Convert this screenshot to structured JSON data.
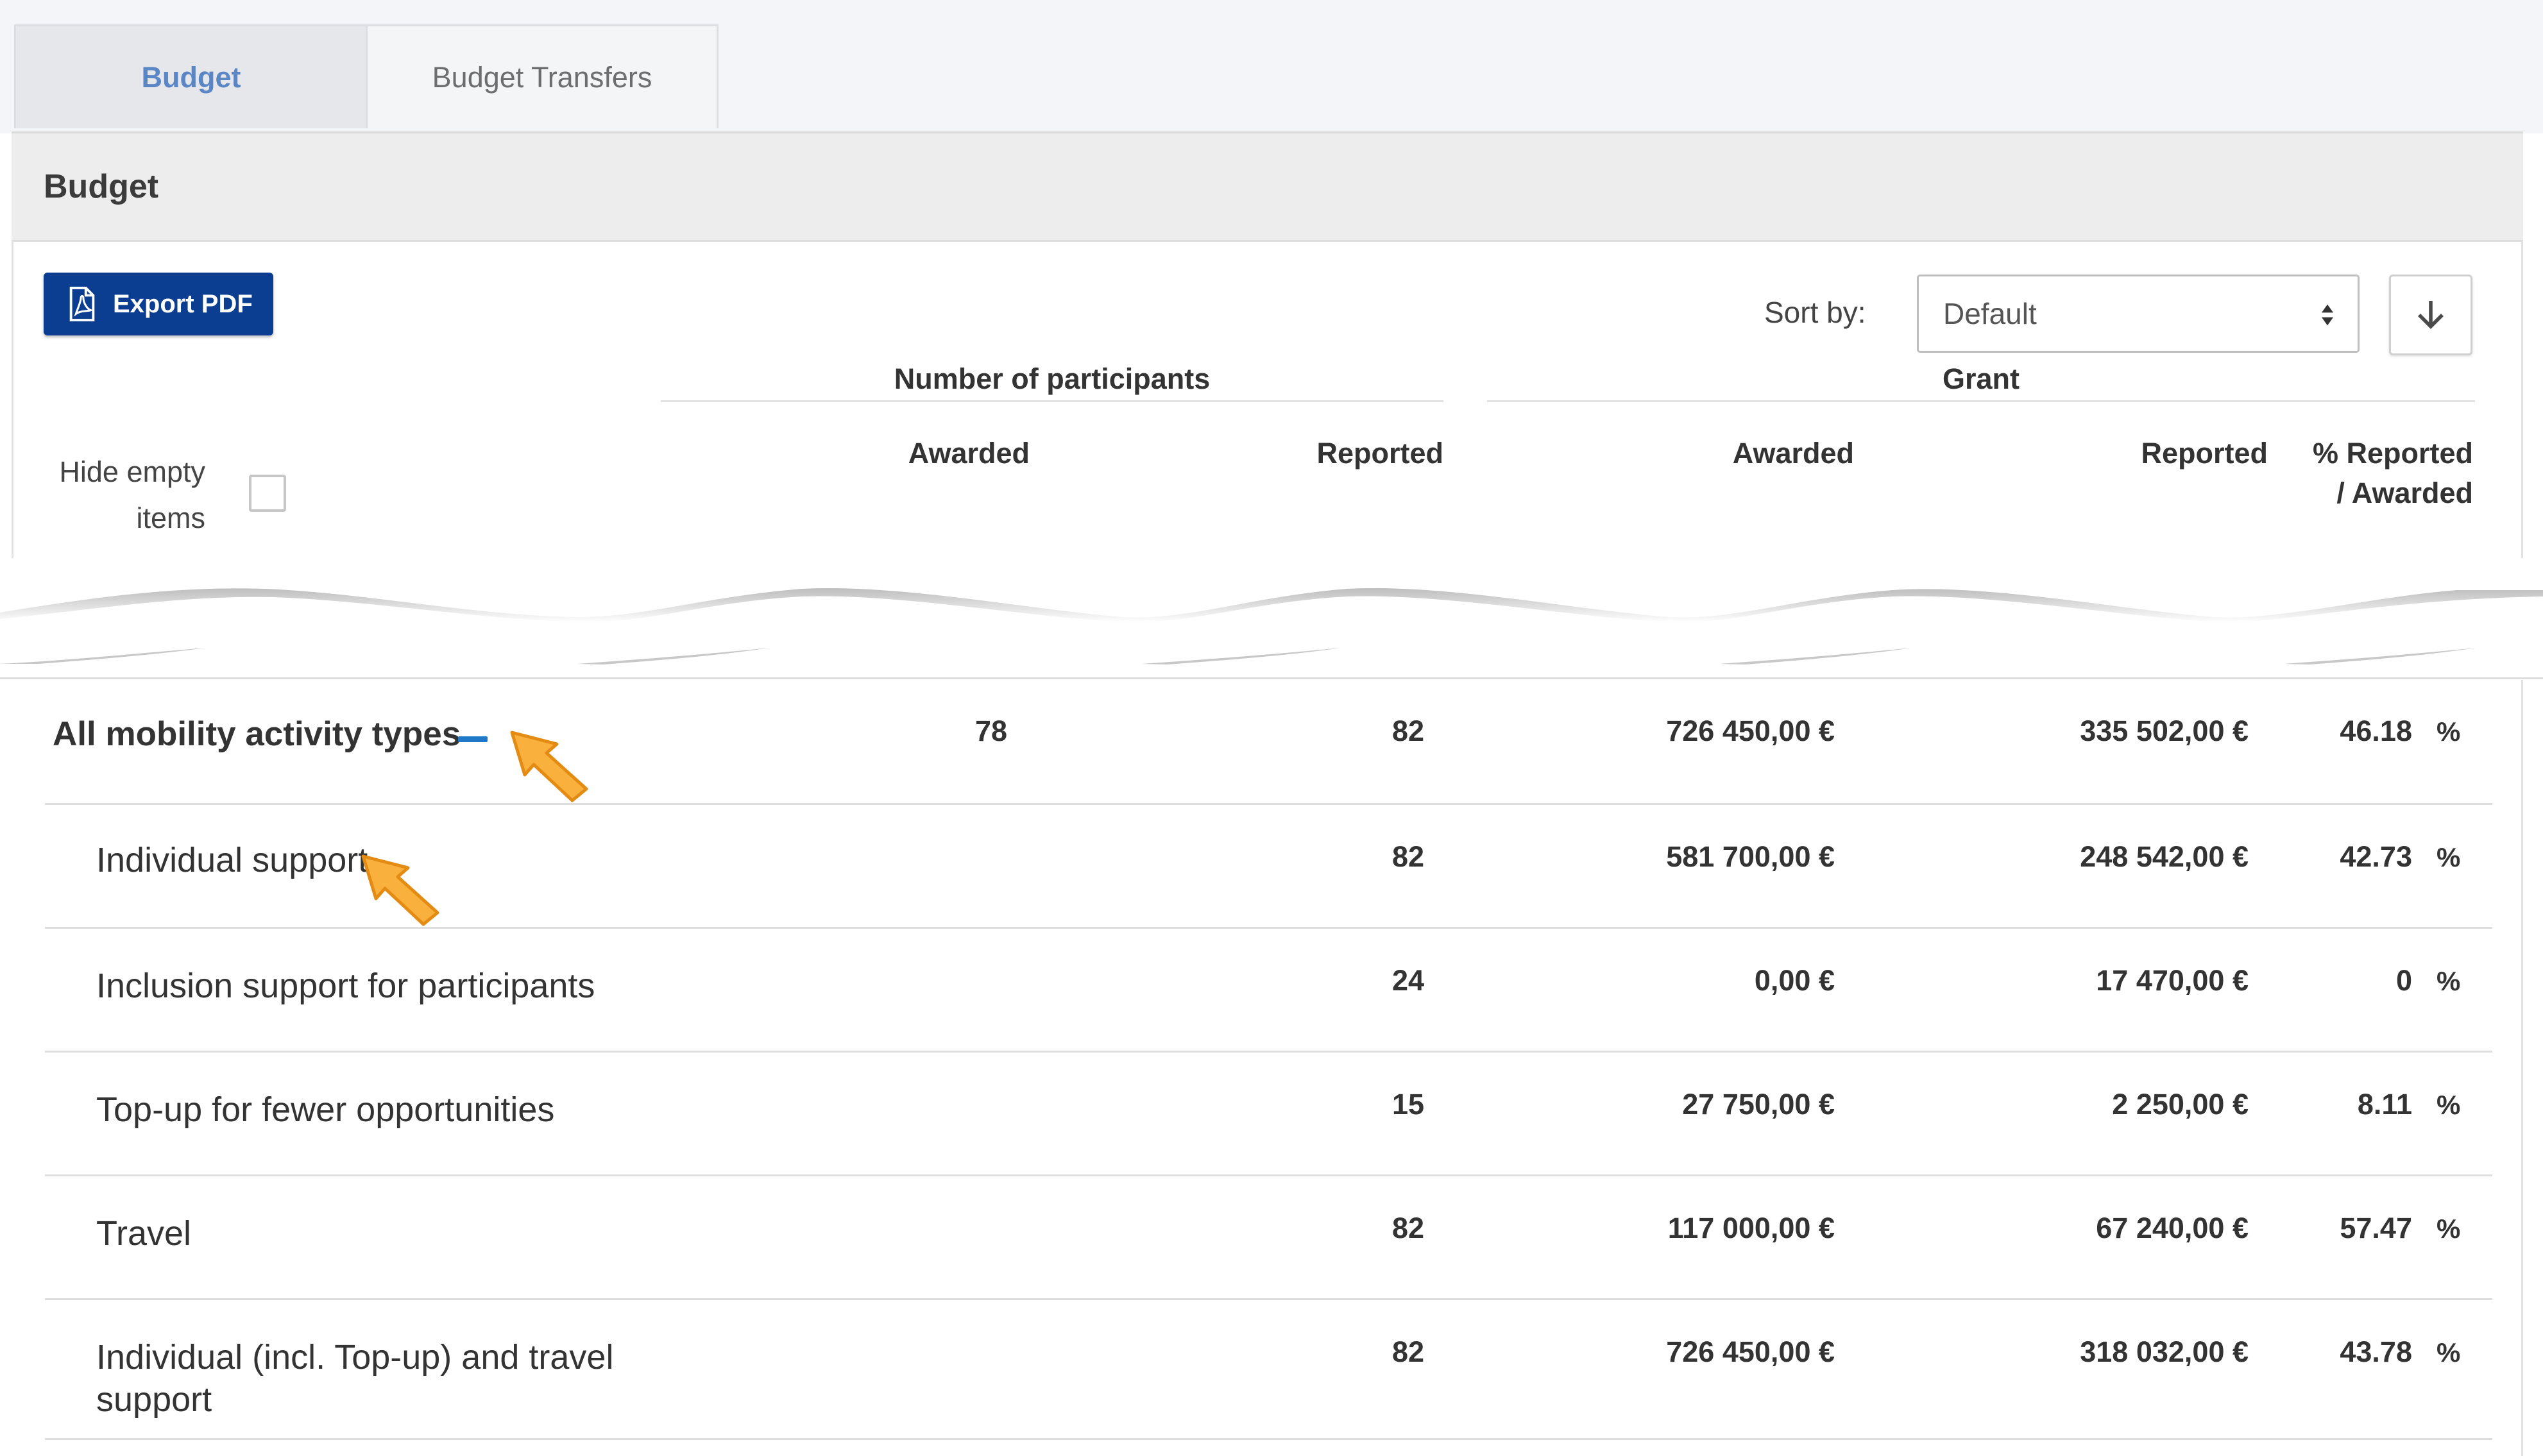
{
  "tabs": [
    {
      "label": "Budget",
      "active": true
    },
    {
      "label": "Budget Transfers",
      "active": false
    }
  ],
  "panel": {
    "title": "Budget"
  },
  "toolbar": {
    "export_label": "Export PDF",
    "sort_label": "Sort by:",
    "sort_value": "Default"
  },
  "filters": {
    "hide_empty_line1": "Hide empty",
    "hide_empty_line2": "items",
    "hide_empty_checked": false
  },
  "table": {
    "group_headers": {
      "participants": "Number of participants",
      "grant": "Grant"
    },
    "columns": {
      "participants_awarded": "Awarded",
      "participants_reported": "Reported",
      "grant_awarded": "Awarded",
      "grant_reported": "Reported",
      "pct_line1": "% Reported",
      "pct_line2": "/ Awarded"
    },
    "rows": [
      {
        "label": "All mobility activity types",
        "participants_awarded": "78",
        "participants_reported": "82",
        "grant_awarded": "726 450,00 €",
        "grant_reported": "335 502,00 €",
        "pct": "46.18",
        "pct_sign": "%"
      },
      {
        "label": "Individual support",
        "participants_awarded": "",
        "participants_reported": "82",
        "grant_awarded": "581 700,00 €",
        "grant_reported": "248 542,00 €",
        "pct": "42.73",
        "pct_sign": "%"
      },
      {
        "label": "Inclusion support for participants",
        "participants_awarded": "",
        "participants_reported": "24",
        "grant_awarded": "0,00 €",
        "grant_reported": "17 470,00 €",
        "pct": "0",
        "pct_sign": "%"
      },
      {
        "label": "Top-up for fewer opportunities",
        "participants_awarded": "",
        "participants_reported": "15",
        "grant_awarded": "27 750,00 €",
        "grant_reported": "2 250,00 €",
        "pct": "8.11",
        "pct_sign": "%"
      },
      {
        "label": "Travel",
        "participants_awarded": "",
        "participants_reported": "82",
        "grant_awarded": "117 000,00 €",
        "grant_reported": "67 240,00 €",
        "pct": "57.47",
        "pct_sign": "%"
      },
      {
        "label": "Individual (incl. Top-up) and travel support",
        "participants_awarded": "",
        "participants_reported": "82",
        "grant_awarded": "726 450,00 €",
        "grant_reported": "318 032,00 €",
        "pct": "43.78",
        "pct_sign": "%"
      }
    ]
  },
  "colors": {
    "accent": "#0b3d91",
    "active_tab_text": "#5a86c5",
    "collapse_icon": "#1f78c8",
    "highlight_arrow": "#f5a623"
  },
  "icons": [
    "pdf-icon",
    "caret-updown-icon",
    "arrow-down-icon",
    "collapse-minus-icon",
    "pointer-arrow-icon"
  ]
}
